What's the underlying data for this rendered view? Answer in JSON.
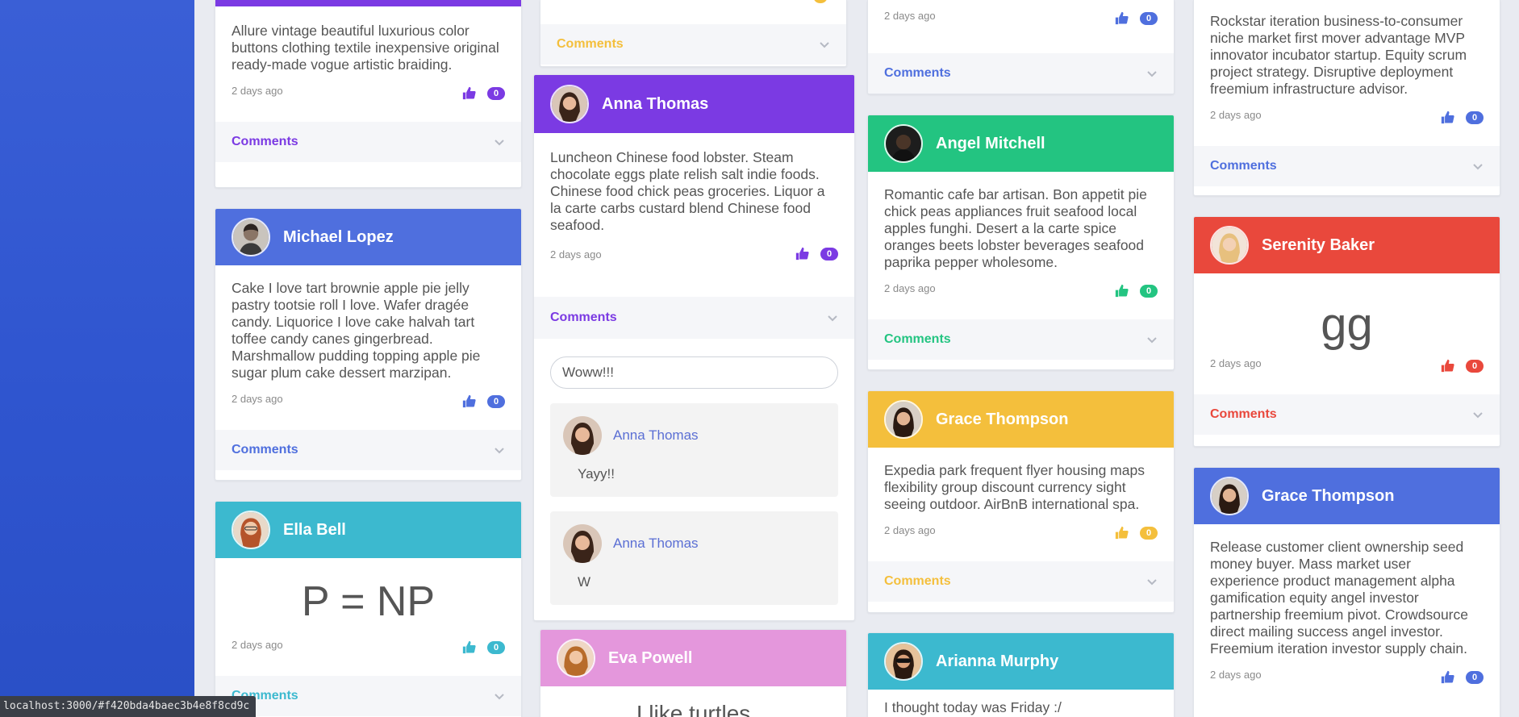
{
  "cards": {
    "c1": {
      "text": "Allure vintage beautiful luxurious color buttons clothing textile inexpensive original ready-made vogue artistic braiding.",
      "time": "2 days ago",
      "count": "0",
      "comments": "Comments",
      "color": "#7b3ae3"
    },
    "c2": {
      "author": "Michael Lopez",
      "text": "Cake I love tart brownie apple pie jelly pastry tootsie roll I love. Wafer dragée candy. Liquorice I love cake halvah tart toffee candy canes gingerbread. Marshmallow pudding topping apple pie sugar plum cake dessert marzipan.",
      "time": "2 days ago",
      "count": "0",
      "comments": "Comments",
      "color": "#4f6fde"
    },
    "c3": {
      "author": "Ella Bell",
      "text": "P = NP",
      "time": "2 days ago",
      "count": "0",
      "comments": "Comments",
      "color": "#3cb9cf"
    },
    "c4": {
      "comments": "Comments",
      "color": "#f4bf3c"
    },
    "c5": {
      "author": "Anna Thomas",
      "text": "Luncheon Chinese food lobster. Steam chocolate eggs plate relish salt indie foods. Chinese food chick peas groceries. Liquor a la carte carbs custard blend Chinese food seafood.",
      "time": "2 days ago",
      "count": "0",
      "comments": "Comments",
      "color": "#7b3ae3",
      "input_value": "Woww!!!",
      "replies": [
        {
          "author": "Anna Thomas",
          "text": "Yayy!!"
        },
        {
          "author": "Anna Thomas",
          "text": "W"
        }
      ]
    },
    "c6": {
      "author": "Eva Powell",
      "text": "I like turtles",
      "color": "#e497dc"
    },
    "c7": {
      "time": "2 days ago",
      "count": "0",
      "comments": "Comments",
      "color": "#4f6fde"
    },
    "c8": {
      "author": "Angel Mitchell",
      "text": "Romantic cafe bar artisan. Bon appetit pie chick peas appliances fruit seafood local apples funghi. Desert a la carte spice oranges beets lobster beverages seafood paprika pepper wholesome.",
      "time": "2 days ago",
      "count": "0",
      "comments": "Comments",
      "color": "#23c481"
    },
    "c9": {
      "author": "Grace Thompson",
      "text": "Expedia park frequent flyer housing maps flexibility group discount currency sight seeing outdoor. AirBnB international spa.",
      "time": "2 days ago",
      "count": "0",
      "comments": "Comments",
      "color": "#f4bf3c"
    },
    "c10": {
      "author": "Arianna Murphy",
      "text": "I thought today was Friday :/",
      "color": "#3cb9cf"
    },
    "c11": {
      "text": "Rockstar iteration business-to-consumer niche market first mover advantage MVP innovator incubator startup. Equity scrum project strategy. Disruptive deployment freemium infrastructure advisor.",
      "time": "2 days ago",
      "count": "0",
      "comments": "Comments",
      "color": "#4f6fde"
    },
    "c12": {
      "author": "Serenity Baker",
      "text": "gg",
      "time": "2 days ago",
      "count": "0",
      "comments": "Comments",
      "color": "#e9483c"
    },
    "c13": {
      "author": "Grace Thompson",
      "text": "Release customer client ownership seed money buyer. Mass market user experience product management alpha gamification equity angel investor partnership freemium pivot. Crowdsource direct mailing success angel investor. Freemium iteration investor supply chain.",
      "time": "2 days ago",
      "count": "0",
      "color": "#4f6fde"
    }
  },
  "status_url": "localhost:3000/#f420bda4baec3b4e8f8cd9c",
  "icons": {
    "like": "thumbs-up-icon",
    "expand": "chevron-down-icon",
    "avatar": "user-photo"
  }
}
